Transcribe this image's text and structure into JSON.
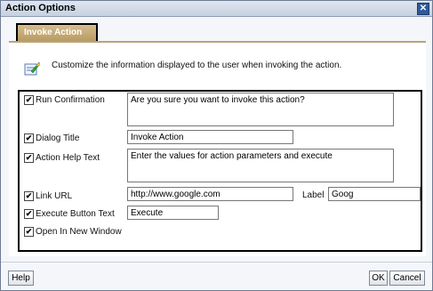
{
  "dialog": {
    "title": "Action Options"
  },
  "tab": {
    "label": "Invoke Action"
  },
  "info": {
    "text": "Customize the information displayed to the user when invoking the action."
  },
  "form": {
    "run_confirmation": {
      "label": "Run Confirmation",
      "checked": true,
      "value": "Are you sure you want to invoke this action?"
    },
    "dialog_title": {
      "label": "Dialog Title",
      "checked": true,
      "value": "Invoke Action"
    },
    "action_help_text": {
      "label": "Action Help Text",
      "checked": true,
      "value": "Enter the values for action parameters and execute"
    },
    "link_url": {
      "label": "Link URL",
      "checked": true,
      "value": "http://www.google.com",
      "link_label_caption": "Label",
      "link_label_value": "Goog"
    },
    "execute_button_text": {
      "label": "Execute Button Text",
      "checked": true,
      "value": "Execute"
    },
    "open_in_new_window": {
      "label": "Open In New Window",
      "checked": true
    }
  },
  "buttons": {
    "help": "Help",
    "ok": "OK",
    "cancel": "Cancel"
  },
  "icons": {
    "close": "close-icon",
    "check": "checkmark",
    "info": "action-icon"
  },
  "colors": {
    "tab": "#c4a874",
    "titlebar": "#cfd8e6"
  }
}
